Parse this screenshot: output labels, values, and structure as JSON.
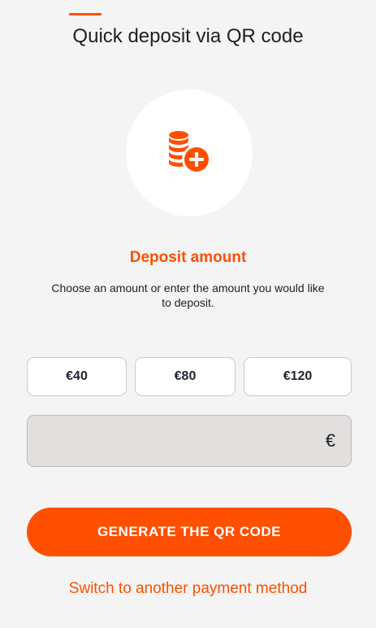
{
  "header": {
    "title": "Quick deposit via QR code"
  },
  "hero": {
    "icon": "coins-plus-icon"
  },
  "deposit": {
    "heading": "Deposit amount",
    "description": "Choose an amount or enter the amount you would like to deposit."
  },
  "amount_options": [
    {
      "label": "€40"
    },
    {
      "label": "€80"
    },
    {
      "label": "€120"
    }
  ],
  "amount_input": {
    "value": "",
    "placeholder": "",
    "currency_symbol": "€"
  },
  "actions": {
    "generate_label": "GENERATE THE QR CODE",
    "switch_label": "Switch to another payment method"
  },
  "colors": {
    "accent": "#ff4f00",
    "background": "#f4f4f4",
    "input_background": "#e2dfdf"
  }
}
